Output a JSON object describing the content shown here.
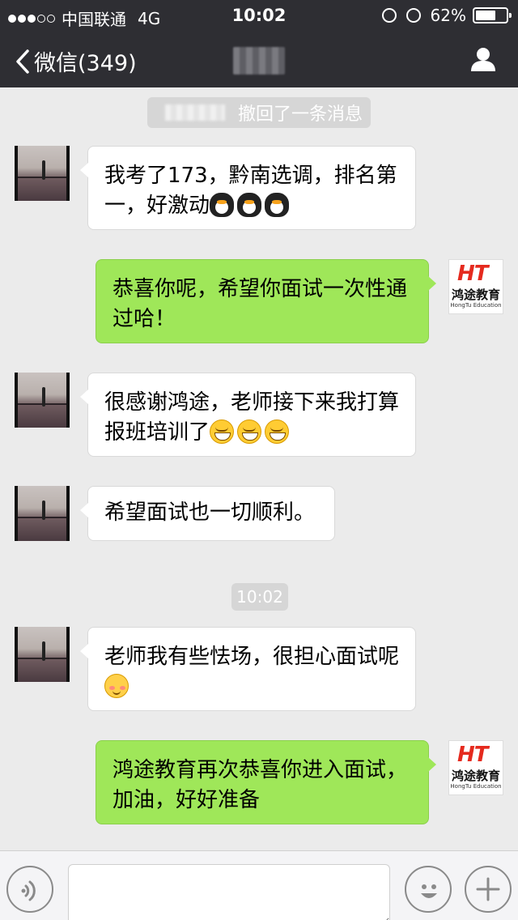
{
  "status_bar": {
    "carrier": "中国联通",
    "network": "4G",
    "time": "10:02",
    "battery": "62%",
    "signal_bars_filled": 3,
    "signal_bars_total": 5
  },
  "nav": {
    "back_label": "微信(349)",
    "title_obscured": true
  },
  "chat": {
    "recall_notice": "撤回了一条消息",
    "timestamp": "10:02",
    "messages": [
      {
        "side": "in",
        "text": "我考了173，黔南选调，排名第一，好激动",
        "emoji": "penguin",
        "emoji_count": 3
      },
      {
        "side": "out",
        "text": "恭喜你呢，希望你面试一次性通过哈！"
      },
      {
        "side": "in",
        "text": "很感谢鸿途，老师接下来我打算报班培训了",
        "emoji": "grin",
        "emoji_count": 3
      },
      {
        "side": "in",
        "text": "希望面试也一切顺利。"
      },
      {
        "side": "in",
        "text": "老师我有些怯场，很担心面试呢",
        "emoji": "shy",
        "emoji_count": 1
      },
      {
        "side": "out",
        "text": "鸿途教育再次恭喜你进入面试，加油，好好准备"
      }
    ]
  },
  "brand": {
    "logo_mark": "HT",
    "logo_name": "鸿途教育",
    "logo_en": "HongTu Education",
    "logo_color": "#e52a1e"
  },
  "colors": {
    "header_bg": "#2e2e33",
    "chat_bg": "#ebebeb",
    "out_bubble": "#9fe759",
    "in_bubble": "#ffffff"
  },
  "input_bar": {
    "text_value": "",
    "icons": [
      "voice-icon",
      "emoji-icon",
      "plus-icon"
    ]
  }
}
